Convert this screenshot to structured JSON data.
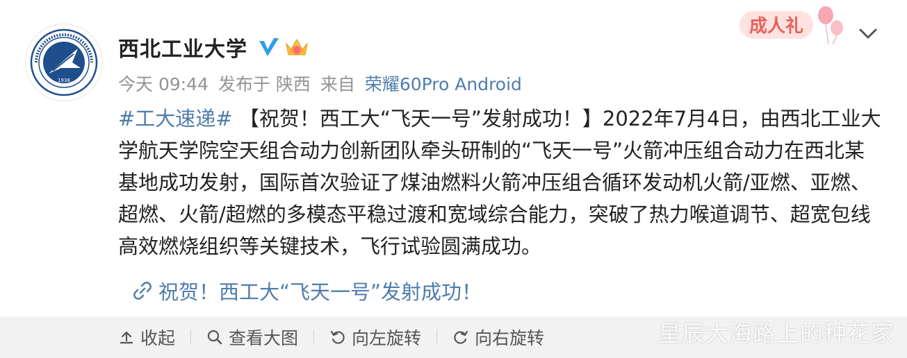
{
  "account": {
    "name": "西北工业大学",
    "avatar_icon": "university-seal-icon",
    "avatar_year": "1938",
    "verified_icon": "verified-v-icon",
    "crown_icon": "crown-badge-icon"
  },
  "meta": {
    "time": "今天 09:44",
    "published_from": "发布于 陕西",
    "via_label": "来自",
    "device": "荣耀60Pro Android"
  },
  "post": {
    "topic": "#工大速递#",
    "text": " 【祝贺！西工大“飞天一号”发射成功！】2022年7月4日，由西北工业大学航天学院空天组合动力创新团队牵头研制的“飞天一号”火箭冲压组合动力在西北某基地成功发射，国际首次验证了煤油燃料火箭冲压组合循环发动机火箭/亚燃、亚燃、超燃、火箭/超燃的多模态平稳过渡和宽域综合能力，突破了热力喉道调节、超宽包线高效燃烧组织等关键技术，飞行试验圆满成功。"
  },
  "link": {
    "icon": "link-icon",
    "label": "祝贺！西工大“飞天一号”发射成功！"
  },
  "badge": {
    "label": "成人礼",
    "icon": "balloon-icon"
  },
  "toolbar": {
    "collapse": "收起",
    "view_large": "查看大图",
    "rotate_left": "向左旋转",
    "rotate_right": "向右旋转"
  },
  "watermark": "星辰大海路上的种花家",
  "colors": {
    "link": "#4f7cac",
    "seal": "#1f4e8c",
    "verify": "#2f9ee8"
  }
}
